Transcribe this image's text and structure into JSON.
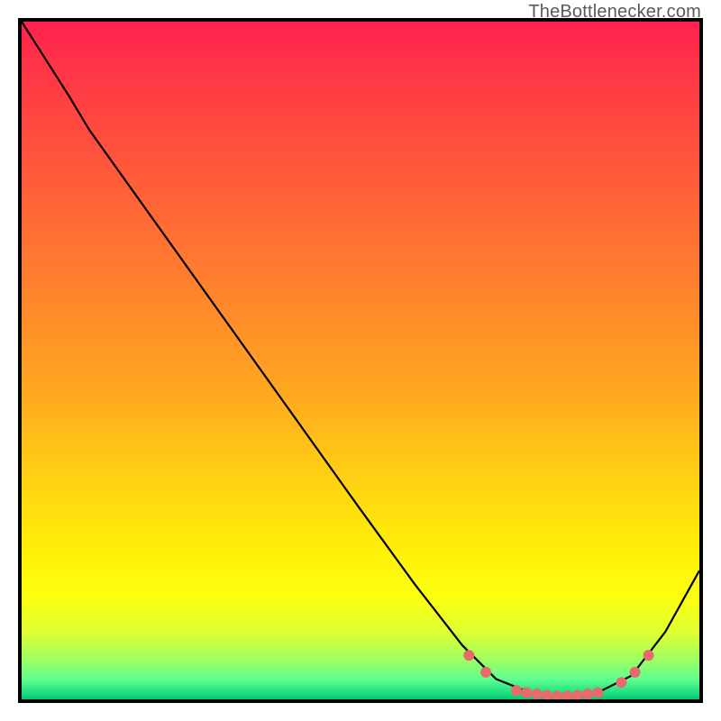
{
  "watermark": "TheBottlenecker.com",
  "chart_data": {
    "type": "line",
    "title": "",
    "xlabel": "",
    "ylabel": "",
    "xlim": [
      0,
      100
    ],
    "ylim": [
      0,
      100
    ],
    "curve": {
      "points": [
        {
          "x": 0.0,
          "y": 100.0
        },
        {
          "x": 7.0,
          "y": 89.0
        },
        {
          "x": 10.0,
          "y": 84.0
        },
        {
          "x": 20.0,
          "y": 70.0
        },
        {
          "x": 30.0,
          "y": 56.0
        },
        {
          "x": 40.0,
          "y": 42.0
        },
        {
          "x": 50.0,
          "y": 28.0
        },
        {
          "x": 58.0,
          "y": 17.0
        },
        {
          "x": 65.0,
          "y": 8.0
        },
        {
          "x": 70.0,
          "y": 3.0
        },
        {
          "x": 75.0,
          "y": 1.0
        },
        {
          "x": 80.0,
          "y": 0.5
        },
        {
          "x": 85.0,
          "y": 1.0
        },
        {
          "x": 90.0,
          "y": 3.5
        },
        {
          "x": 95.0,
          "y": 10.0
        },
        {
          "x": 100.0,
          "y": 19.0
        }
      ]
    },
    "markers": [
      {
        "x": 66.0,
        "y": 6.5
      },
      {
        "x": 68.5,
        "y": 4.0
      },
      {
        "x": 73.0,
        "y": 1.3
      },
      {
        "x": 74.5,
        "y": 1.0
      },
      {
        "x": 76.0,
        "y": 0.8
      },
      {
        "x": 77.5,
        "y": 0.6
      },
      {
        "x": 79.0,
        "y": 0.5
      },
      {
        "x": 80.5,
        "y": 0.5
      },
      {
        "x": 82.0,
        "y": 0.6
      },
      {
        "x": 83.5,
        "y": 0.8
      },
      {
        "x": 85.0,
        "y": 1.0
      },
      {
        "x": 88.5,
        "y": 2.5
      },
      {
        "x": 90.5,
        "y": 4.0
      },
      {
        "x": 92.5,
        "y": 6.5
      }
    ],
    "marker_color": "#e86a6a",
    "line_color": "#000000"
  }
}
